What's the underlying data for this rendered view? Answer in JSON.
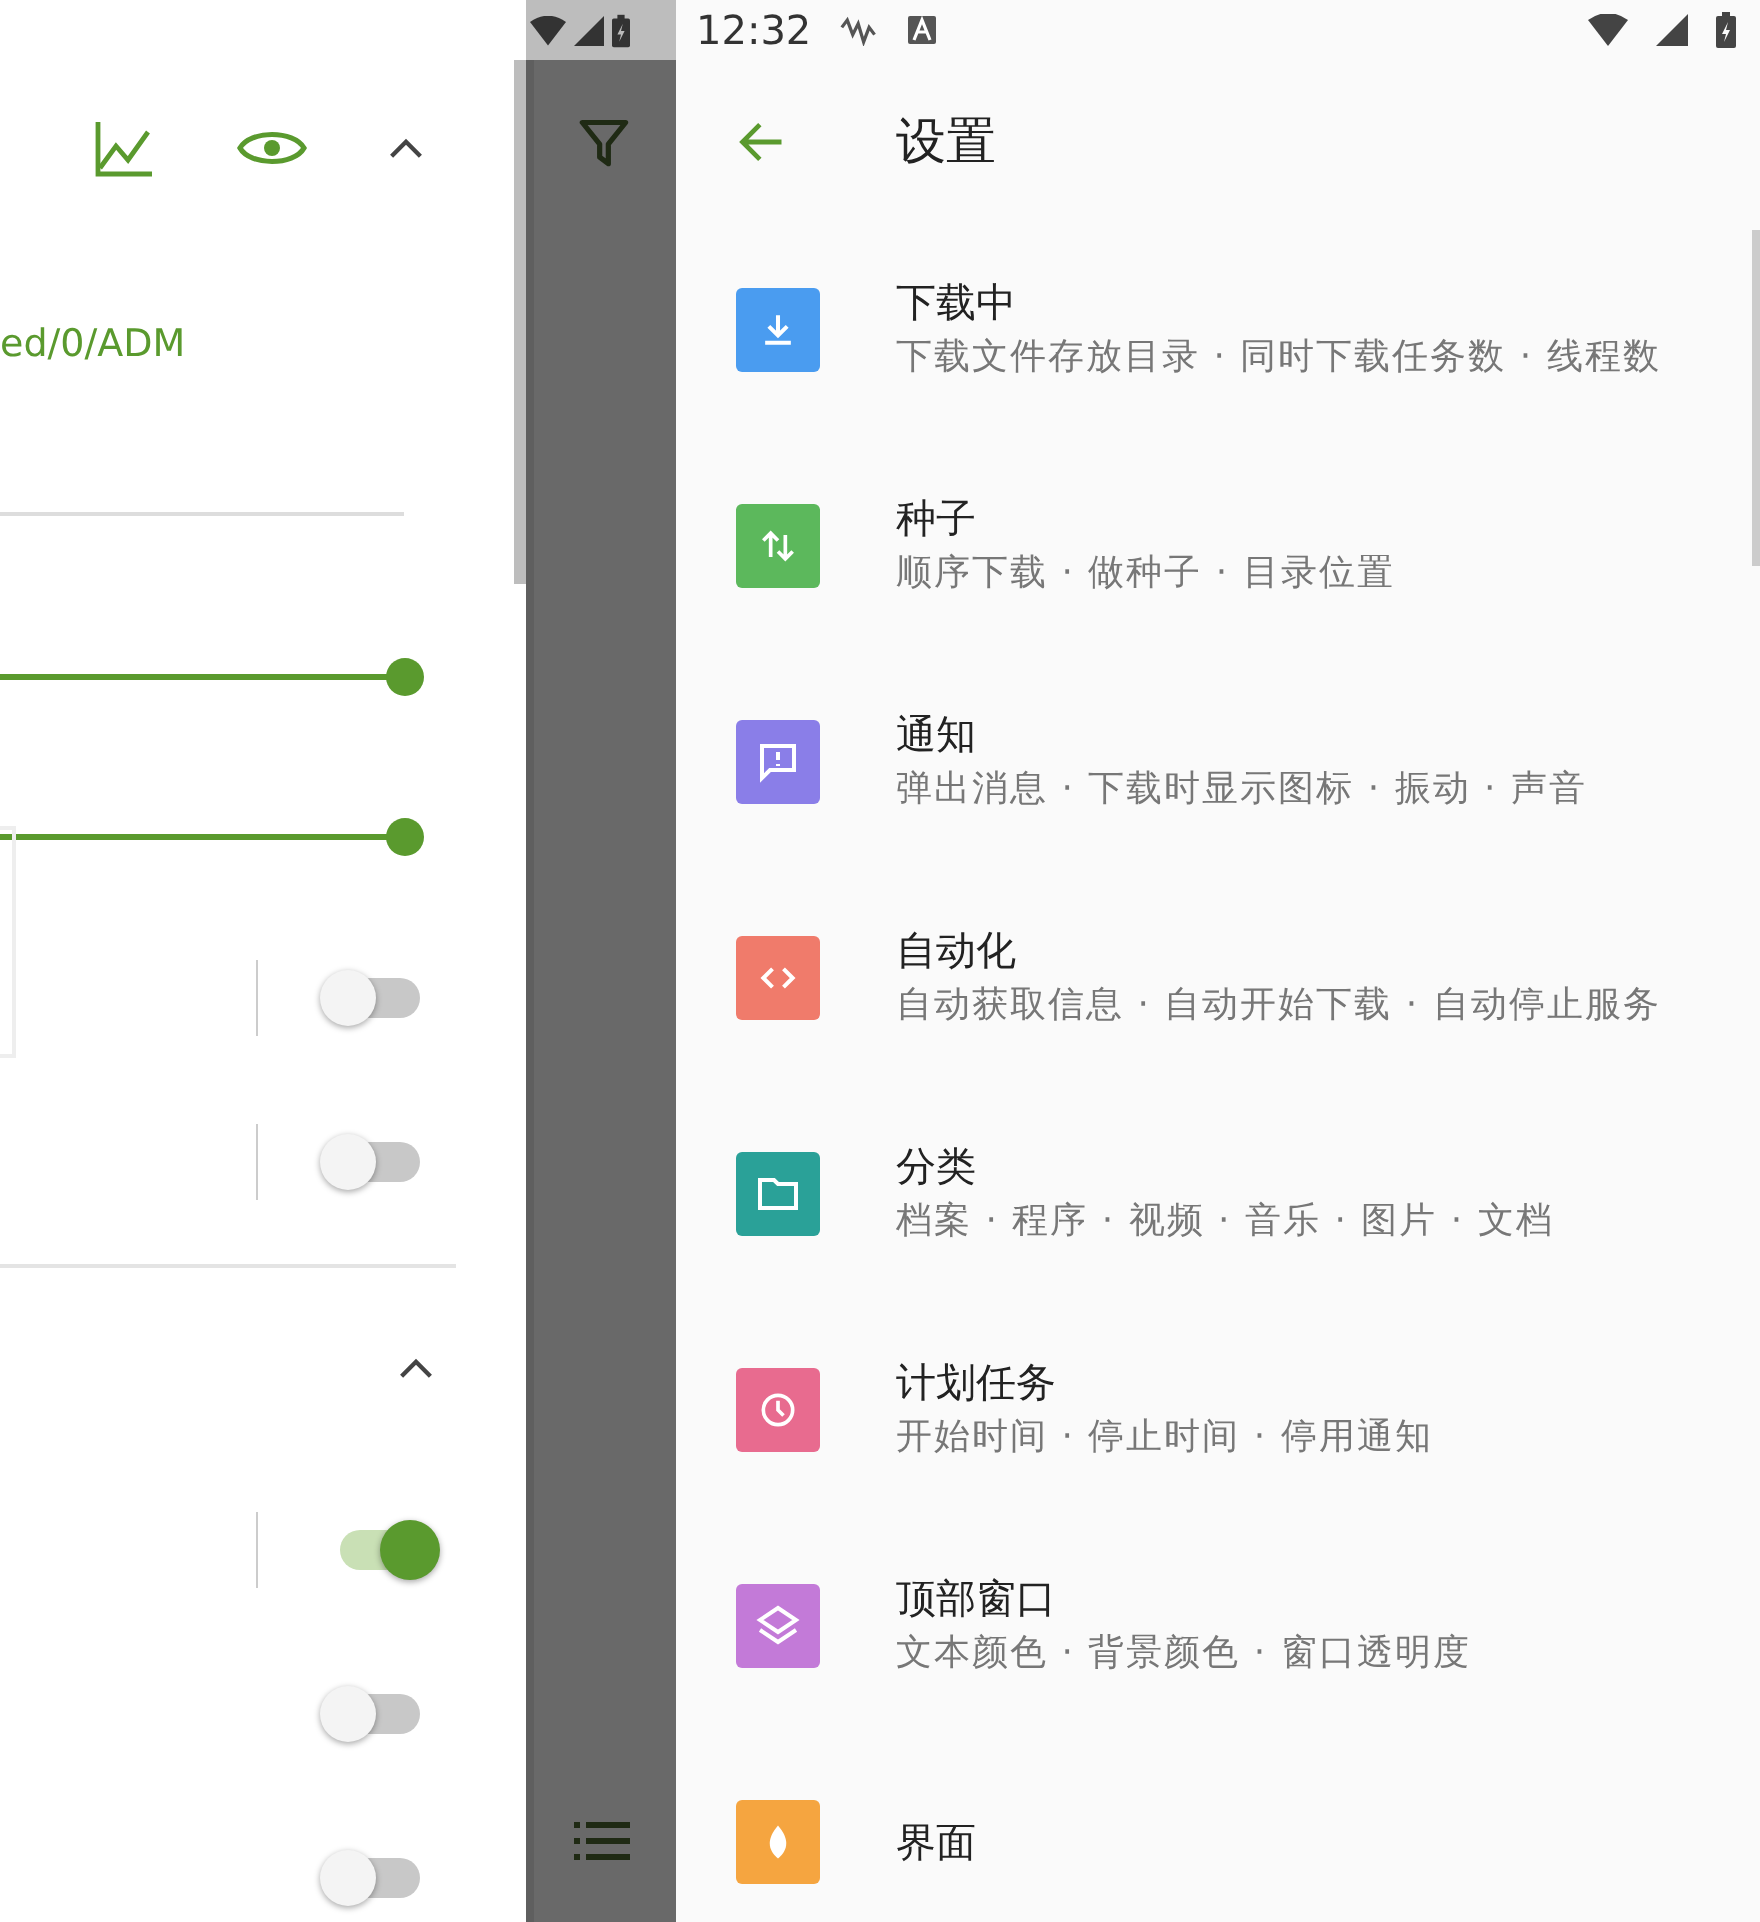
{
  "status_bar": {
    "time": "12:32"
  },
  "left_panel": {
    "path_text": "ed/0/ADM",
    "sliders": [
      {
        "level": 1
      },
      {
        "level": 1
      }
    ],
    "toggles": [
      {
        "on": false,
        "separator": true
      },
      {
        "on": false,
        "separator": true
      }
    ],
    "section": {
      "expanded": true,
      "toggles": [
        {
          "on": true,
          "separator": true
        },
        {
          "on": false,
          "separator": false
        },
        {
          "on": false,
          "separator": false
        }
      ]
    }
  },
  "settings": {
    "title": "设置",
    "items": [
      {
        "title": "下载中",
        "summary": "下载文件存放目录 · 同时下载任务数 · 线程数",
        "color": "#4a9cf0"
      },
      {
        "title": "种子",
        "summary": "顺序下载 · 做种子 · 目录位置",
        "color": "#5cb85c"
      },
      {
        "title": "通知",
        "summary": "弹出消息 · 下载时显示图标 · 振动 · 声音",
        "color": "#8a7ee8"
      },
      {
        "title": "自动化",
        "summary": "自动获取信息 · 自动开始下载 · 自动停止服务",
        "color": "#f07b6b"
      },
      {
        "title": "分类",
        "summary": "档案 · 程序 · 视频 · 音乐 · 图片 · 文档",
        "color": "#2aa198"
      },
      {
        "title": "计划任务",
        "summary": "开始时间 · 停止时间 · 停用通知",
        "color": "#e86b8f"
      },
      {
        "title": "顶部窗口",
        "summary": "文本颜色 · 背景颜色 · 窗口透明度",
        "color": "#c37ad8"
      },
      {
        "title": "界面",
        "color": "#f5a540"
      }
    ]
  }
}
